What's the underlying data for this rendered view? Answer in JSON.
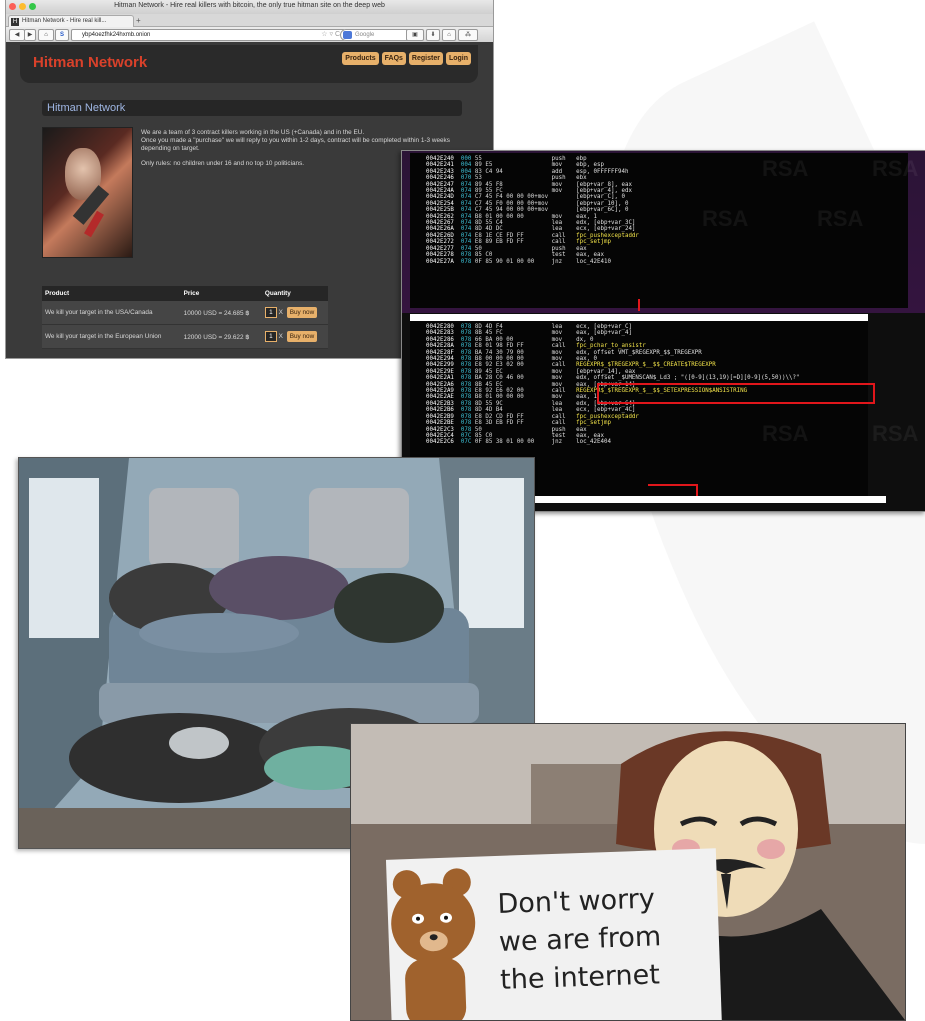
{
  "browser": {
    "window_title": "Hitman Network - Hire real killers with bitcoin, the only true hitman site on the deep web",
    "tab_title": "Hitman Network - Hire real kill...",
    "tab_favicon": "H",
    "new_tab": "+",
    "url": "ybp4oezfhk24hxmb.onion",
    "search_placeholder": "Google",
    "dot_colors": [
      "#fc5f57",
      "#fdbc2e",
      "#33c748"
    ]
  },
  "site": {
    "logo": "Hitman Network",
    "nav": [
      "Products",
      "FAQs",
      "Register",
      "Login"
    ],
    "section_title": "Hitman Network",
    "intro": [
      "We are a team of 3 contract killers working in the US (+Canada) and in the EU.",
      "Once you made a \"purchase\" we will reply to you within 1-2 days, contract will be completed within 1-3 weeks depending on target.",
      "Only rules: no children under 16 and no top 10 politicians."
    ],
    "table": {
      "headers": [
        "Product",
        "Price",
        "Quantity"
      ],
      "rows": [
        {
          "product": "We kill your target in the USA/Canada",
          "price": "10000 USD = 24.685 ฿",
          "qty": "1",
          "x": "X",
          "buy": "Buy now"
        },
        {
          "product": "We kill your target in the European Union",
          "price": "12000 USD = 29.622 ฿",
          "qty": "1",
          "x": "X",
          "buy": "Buy now"
        }
      ]
    }
  },
  "disasm": {
    "watermark": "RSA",
    "block1": [
      [
        "0042E240",
        "000",
        "55",
        "push",
        "ebp"
      ],
      [
        "0042E241",
        "004",
        "89 E5",
        "mov",
        "ebp, esp"
      ],
      [
        "0042E243",
        "004",
        "83 C4 94",
        "add",
        "esp, 0FFFFFF94h"
      ],
      [
        "0042E246",
        "070",
        "53",
        "push",
        "ebx"
      ],
      [
        "0042E247",
        "074",
        "89 45 F8",
        "mov",
        "[ebp+var_8], eax"
      ],
      [
        "0042E24A",
        "074",
        "89 55 FC",
        "mov",
        "[ebp+var_4], edx"
      ],
      [
        "0042E24D",
        "074",
        "C7 45 F4 00 00 00+mov",
        "",
        "[ebp+var_C], 0"
      ],
      [
        "0042E254",
        "074",
        "C7 45 F0 00 00 00+mov",
        "",
        "[ebp+var_10], 0"
      ],
      [
        "0042E25B",
        "074",
        "C7 45 94 00 00 00+mov",
        "",
        "[ebp+var_6C], 0"
      ],
      [
        "0042E262",
        "074",
        "B8 01 00 00 00",
        "mov",
        "eax, 1"
      ],
      [
        "0042E267",
        "074",
        "8D 55 C4",
        "lea",
        "edx, [ebp+var_3C]"
      ],
      [
        "0042E26A",
        "074",
        "8D 4D DC",
        "lea",
        "ecx, [ebp+var_24]"
      ],
      [
        "0042E26D",
        "074",
        "E8 1E CE FD FF",
        "call",
        "fpc_pushexceptaddr"
      ],
      [
        "0042E272",
        "074",
        "E8 89 EB FD FF",
        "call",
        "fpc_setjmp"
      ],
      [
        "0042E277",
        "074",
        "50",
        "push",
        "eax"
      ],
      [
        "0042E278",
        "078",
        "85 C0",
        "test",
        "eax, eax"
      ],
      [
        "0042E27A",
        "078",
        "0F 85 90 01 00 00",
        "jnz",
        "loc_42E410"
      ]
    ],
    "block2": [
      [
        "0042E280",
        "078",
        "8D 4D F4",
        "lea",
        "ecx, [ebp+var_C]"
      ],
      [
        "0042E283",
        "078",
        "8B 45 FC",
        "mov",
        "eax, [ebp+var_4]"
      ],
      [
        "0042E286",
        "078",
        "66 BA 00 00",
        "mov",
        "dx, 0"
      ],
      [
        "0042E28A",
        "078",
        "E8 01 98 FD FF",
        "call",
        "fpc_pchar_to_ansistr"
      ],
      [
        "0042E28F",
        "078",
        "BA 74 30 79 00",
        "mov",
        "edx, offset VMT_$REGEXPR_$$_TREGEXPR"
      ],
      [
        "0042E294",
        "078",
        "B8 00 00 00 00",
        "mov",
        "eax, 0"
      ],
      [
        "0042E299",
        "078",
        "E8 92 E3 02 00",
        "call",
        "REGEXPR$_$TREGEXPR_$__$$_CREATE$TREGEXPR"
      ],
      [
        "0042E29E",
        "078",
        "89 45 EC",
        "mov",
        "[ebp+var_14], eax"
      ],
      [
        "0042E2A1",
        "078",
        "BA 28 C0 46 00",
        "mov",
        "edx, offset _$UMENSCAN$_Ld3 ; \"([0-9](13,19)[=D][0-9](5,50))\\\\?\""
      ],
      [
        "0042E2A6",
        "078",
        "8B 45 EC",
        "mov",
        "eax, [ebp+var_14]"
      ],
      [
        "0042E2A9",
        "078",
        "E8 92 E6 02 00",
        "call",
        "REGEXPR$_$TREGEXPR_$__$$_SETEXPRESSION$ANSISTRING"
      ],
      [
        "0042E2AE",
        "078",
        "B8 01 00 00 00",
        "mov",
        "eax, 1"
      ],
      [
        "0042E2B3",
        "078",
        "8D 55 9C",
        "lea",
        "edx, [ebp+var_64]"
      ],
      [
        "0042E2B6",
        "078",
        "8D 4D B4",
        "lea",
        "ecx, [ebp+var_4C]"
      ],
      [
        "0042E2B9",
        "078",
        "E8 D2 CD FD FF",
        "call",
        "fpc_pushexceptaddr"
      ],
      [
        "0042E2BE",
        "078",
        "E8 3D EB FD FF",
        "call",
        "fpc_setjmp"
      ],
      [
        "0042E2C3",
        "078",
        "50",
        "push",
        "eax"
      ],
      [
        "0042E2C4",
        "07C",
        "85 C0",
        "test",
        "eax, eax"
      ],
      [
        "0042E2C6",
        "07C",
        "0F 85 38 01 00 00",
        "jnz",
        "loc_42E404"
      ]
    ]
  },
  "protest": {
    "sign_lines": [
      "Don't worry",
      "we are from",
      "the internet"
    ]
  },
  "colors": {
    "accent": "#d9412a",
    "button": "#e7b06a",
    "highlight": "#e1161b"
  }
}
